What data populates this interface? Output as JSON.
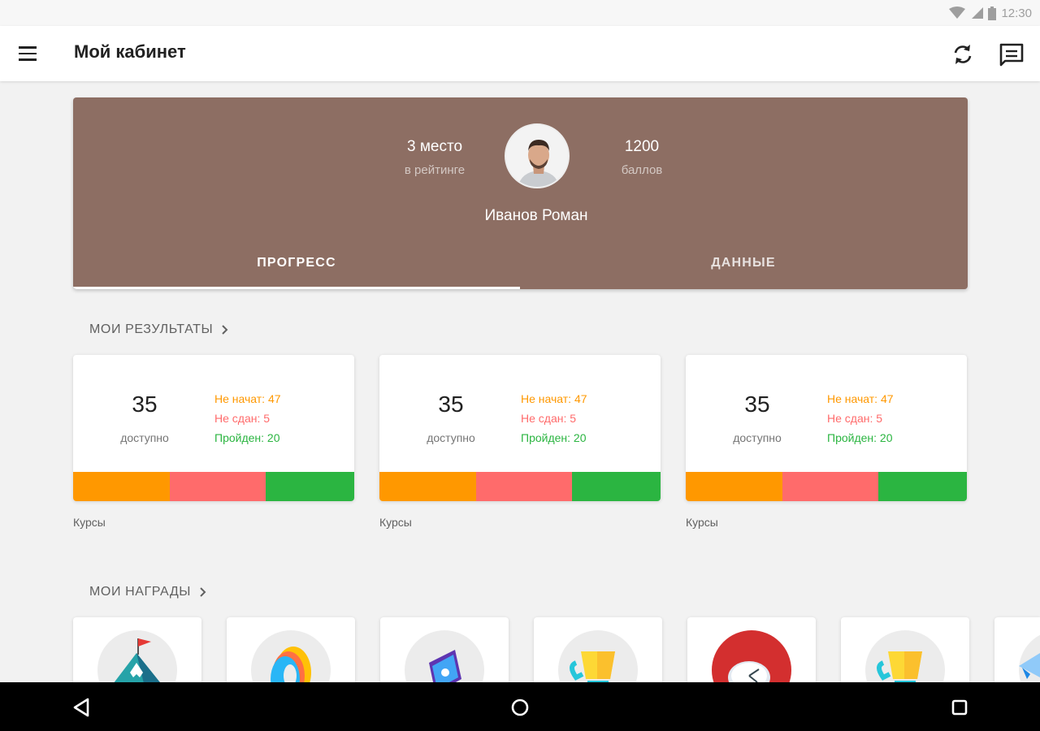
{
  "status_bar": {
    "time": "12:30",
    "icons": [
      "wifi-icon",
      "signal-icon",
      "battery-icon"
    ]
  },
  "app_bar": {
    "title": "Мой кабинет",
    "menu_icon": "hamburger-menu-icon",
    "actions": [
      "refresh-icon",
      "message-icon"
    ]
  },
  "profile": {
    "rank_value": "3 место",
    "rank_label": "в рейтинге",
    "points_value": "1200",
    "points_label": "баллов",
    "name": "Иванов Роман",
    "background_color": "#8d6e63",
    "tabs": [
      {
        "label": "ПРОГРЕСС",
        "active": true
      },
      {
        "label": "ДАННЫЕ",
        "active": false
      }
    ]
  },
  "results": {
    "title": "МОИ РЕЗУЛЬТАТЫ",
    "cards": [
      {
        "count": "35",
        "count_label": "доступно",
        "not_started": "Не начат: 47",
        "not_passed": "Не сдан: 5",
        "passed": "Пройден: 20",
        "caption": "Курсы"
      },
      {
        "count": "35",
        "count_label": "доступно",
        "not_started": "Не начат: 47",
        "not_passed": "Не сдан: 5",
        "passed": "Пройден: 20",
        "caption": "Курсы"
      },
      {
        "count": "35",
        "count_label": "доступно",
        "not_started": "Не начат: 47",
        "not_passed": "Не сдан: 5",
        "passed": "Пройден: 20",
        "caption": "Курсы"
      }
    ],
    "colors": {
      "not_started": "#ff9800",
      "not_passed": "#ff6b6b",
      "passed": "#2bb541"
    }
  },
  "awards": {
    "title": "МОИ НАГРАДЫ",
    "items": [
      "mountain-flag-icon",
      "colorful-ring-icon",
      "phone-heart-icon",
      "trophy-icon",
      "clock-icon",
      "trophy-icon",
      "paper-plane-icon"
    ]
  },
  "nav_bar": {
    "buttons": [
      "back-icon",
      "home-icon",
      "recents-icon"
    ]
  }
}
